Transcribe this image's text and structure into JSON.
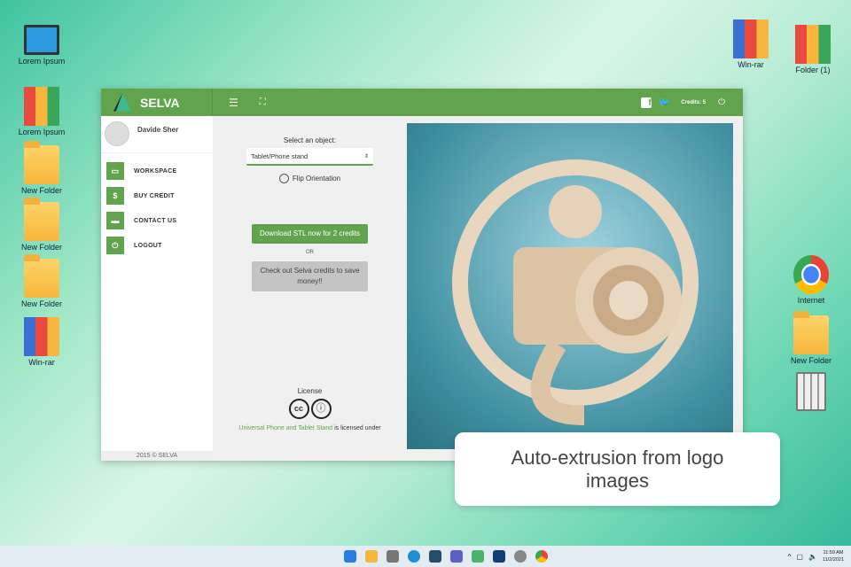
{
  "desktop": {
    "left_icons": [
      "Lorem Ipsum",
      "Lorem Ipsum",
      "New Folder",
      "New Folder",
      "New Folder",
      "Win-rar"
    ],
    "right_icons": [
      "Win-rar",
      "Folder (1)",
      "Internet",
      "New Folder",
      ""
    ]
  },
  "app": {
    "brand": "SELVA",
    "credits": "Credits: 5",
    "user": "Davide Sher",
    "nav": [
      "WORKSPACE",
      "BUY CREDIT",
      "CONTACT US",
      "LOGOUT"
    ],
    "footer": "2015 © SELVA",
    "select_label": "Select an object:",
    "select_value": "Tablet/Phone stand",
    "flip": "Flip Orientation",
    "download": "Download STL now for 2 credits",
    "or": "OR",
    "credits_btn": "Check out Selva credits to save money!!",
    "license": "License",
    "license_link": "Universal Phone and Tablet Stand",
    "license_rest": " is licensed under"
  },
  "caption": "Auto-extrusion from logo images",
  "taskbar": {
    "time": "11:59 AM",
    "date": "11/2/2021"
  }
}
